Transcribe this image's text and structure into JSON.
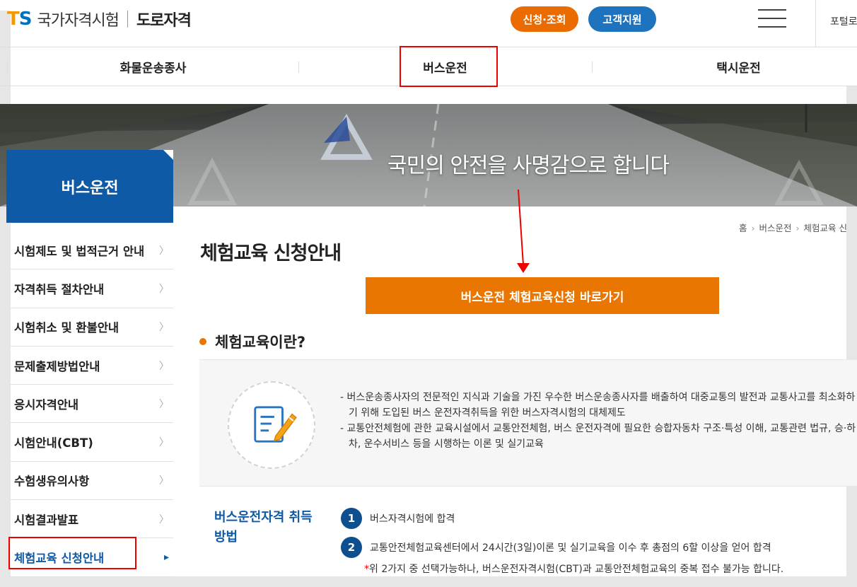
{
  "header": {
    "logo_t": "T",
    "logo_s": "S",
    "logo_text": "국가자격시험",
    "logo_sub": "도로자격",
    "btn_apply": "신청·조회",
    "btn_support": "고객지원",
    "portal": "포털로"
  },
  "mainnav": {
    "items": [
      "화물운송종사",
      "버스운전",
      "택시운전"
    ]
  },
  "banner": {
    "slogan": "국민의 안전을 사명감으로 합니다"
  },
  "sidebar": {
    "title": "버스운전",
    "items": [
      "시험제도 및 법적근거 안내",
      "자격취득 절차안내",
      "시험취소 및 환불안내",
      "문제출제방법안내",
      "응시자격안내",
      "시험안내(CBT)",
      "수험생유의사항",
      "시험결과발표",
      "체험교육 신청안내"
    ],
    "active_index": 8
  },
  "breadcrumb": {
    "home": "홈",
    "level1": "버스운전",
    "level2": "체험교육 신"
  },
  "content": {
    "title": "체험교육 신청안내",
    "cta": "버스운전 체험교육신청 바로가기",
    "section_title": "체험교육이란?",
    "info_lines": [
      "- 버스운송종사자의 전문적인 지식과 기술을 가진 우수한 버스운송종사자를 배출하여 대중교통의 발전과 교통사고를 최소화하기 위해 도입된 버스 운전자격취득을 위한 버스자격시험의 대체제도",
      "- 교통안전체험에 관한 교육시설에서 교통안전체험, 버스 운전자격에 필요한 승합자동차 구조·특성 이해, 교통관련 법규, 승·하차, 운수서비스 등을 시행하는 이론 및 실기교육"
    ],
    "method_title": "버스운전자격 취득 방법",
    "steps": [
      {
        "num": "1",
        "text": "버스자격시험에 합격"
      },
      {
        "num": "2",
        "text": "교통안전체험교육센터에서 24시간(3일)이론 및 실기교육을 이수 후 총점의 6할 이상을 얻어 합격"
      }
    ],
    "note_star": "*",
    "note": "위 2가지 중 선택가능하나, 버스운전자격시험(CBT)과 교통안전체험교육의 중복 접수 불가능 합니다."
  },
  "colors": {
    "orange": "#e87600",
    "blue": "#0e5aa7",
    "highlight": "#e00000"
  }
}
